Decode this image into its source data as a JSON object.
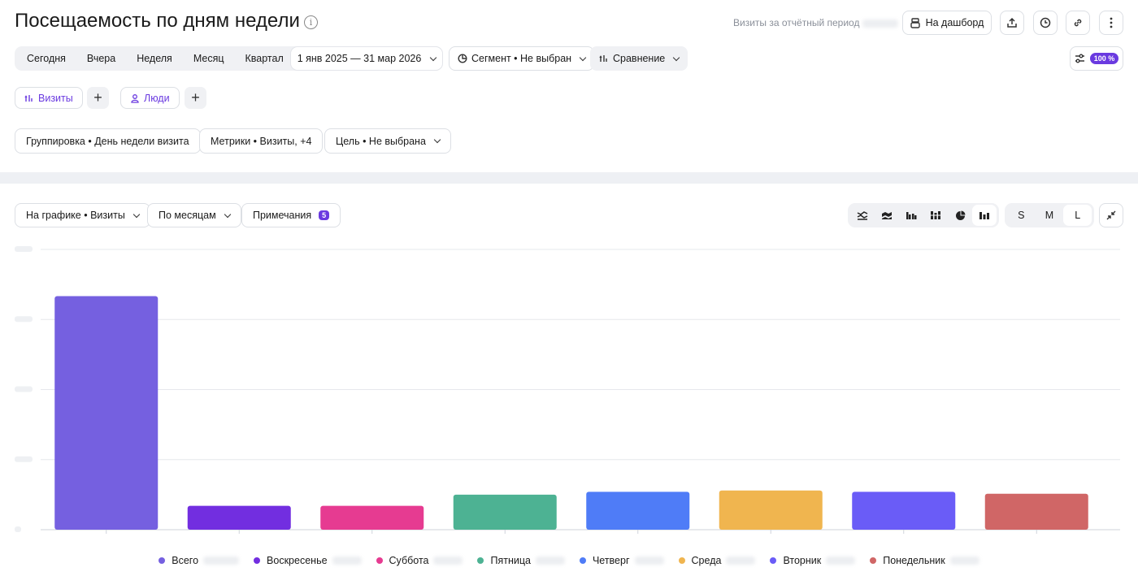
{
  "header": {
    "title": "Посещаемость по дням недели",
    "info_icon": "i",
    "visits_period_label": "Визиты за отчётный период",
    "dashboard_button": "На дашборд",
    "dashboard_icon": "dashboard-icon"
  },
  "period": {
    "tabs": [
      "Сегодня",
      "Вчера",
      "Неделя",
      "Месяц",
      "Квартал"
    ],
    "date_range": "1 янв 2025 — 31 мар 2026",
    "segment": "Сегмент • Не выбран",
    "comparison": "Сравнение",
    "sampling_badge": "100 %"
  },
  "metrics_chips": {
    "visits": "Визиты",
    "people": "Люди",
    "plus": "+"
  },
  "filters": {
    "grouping": "Группировка • День недели визита",
    "metrics": "Метрики • Визиты, +4",
    "goal": "Цель • Не выбрана"
  },
  "chart_controls": {
    "on_chart": "На графике • Визиты",
    "by_months": "По месяцам",
    "notes": "Примечания",
    "notes_count": "5",
    "sizes": [
      "S",
      "M",
      "L"
    ],
    "active_size": "L"
  },
  "colors": {
    "accent": "#6a3ae0",
    "grid": "#e6e8ec"
  },
  "chart_data": {
    "type": "bar",
    "categories": [
      "Всего",
      "Воскресенье",
      "Суббота",
      "Пятница",
      "Четверг",
      "Среда",
      "Вторник",
      "Понедельник"
    ],
    "values": [
      100,
      10.2,
      10.2,
      15,
      16.2,
      16.8,
      16.2,
      15.4
    ],
    "colors": [
      "#7560e0",
      "#722ee0",
      "#e63b91",
      "#4db293",
      "#4f7cf7",
      "#f0b54f",
      "#6a5cf7",
      "#d06666"
    ],
    "ylim": [
      0,
      120
    ],
    "grid": true,
    "legend": "bottom",
    "xlabel": "",
    "ylabel": ""
  }
}
